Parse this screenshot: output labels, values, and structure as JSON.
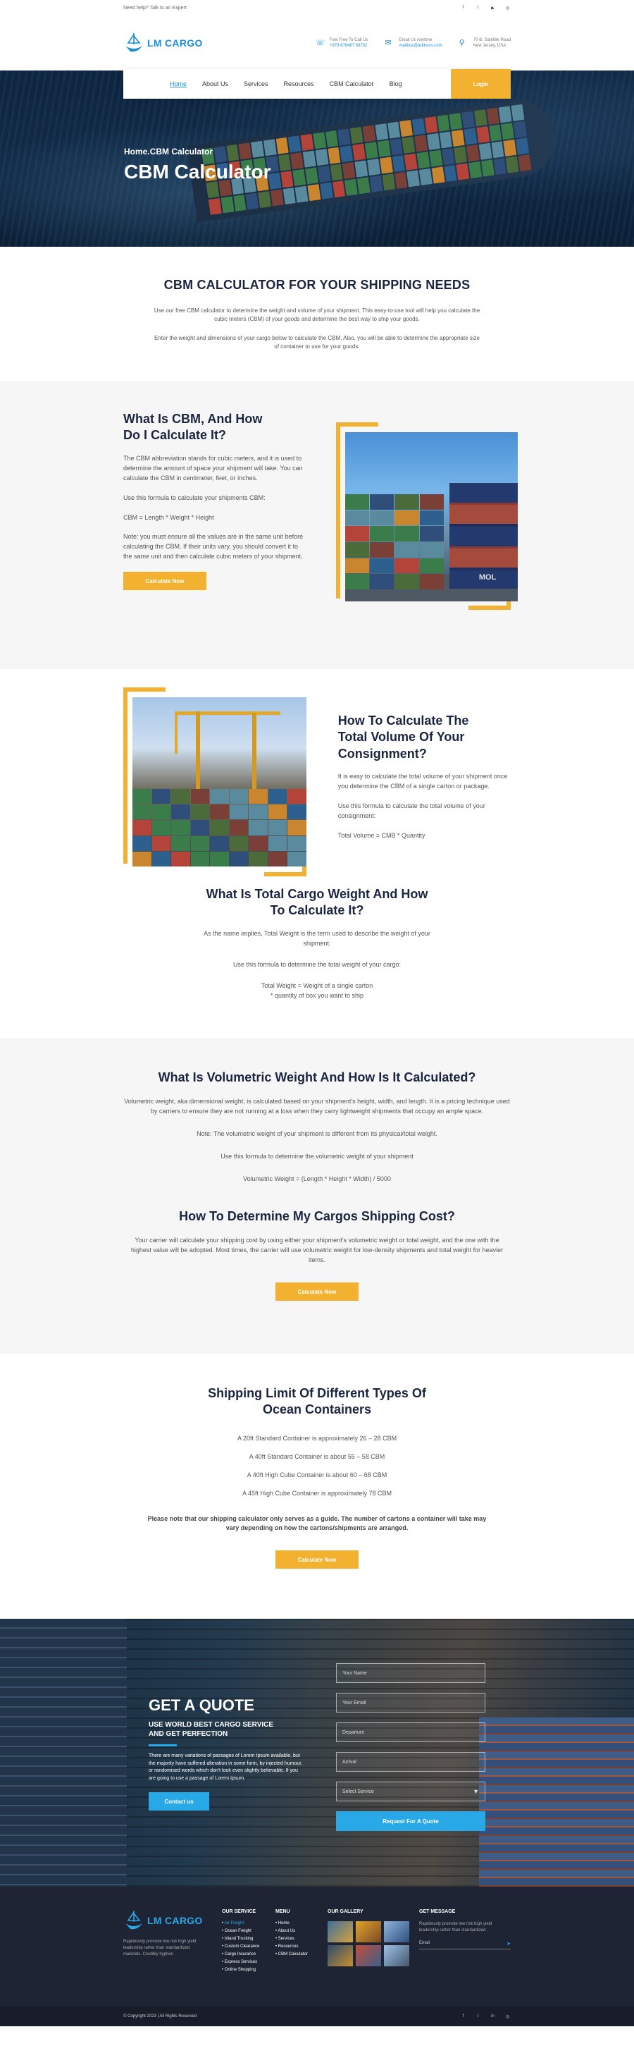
{
  "topbar": {
    "help": "Need help? Talk to an Expert",
    "social_icons": [
      "facebook-icon",
      "twitter-icon",
      "youtube-icon",
      "instagram-icon"
    ]
  },
  "header": {
    "logo": "LM CARGO",
    "contacts": [
      {
        "icon": "phone-icon",
        "line1": "Feel Free To Call Us",
        "line2": "+879 876467 88732"
      },
      {
        "icon": "mail-icon",
        "line1": "Email Us Anytime",
        "line2": "mailbox@address.com"
      },
      {
        "icon": "location-icon",
        "line1": "70-B, Satellite Road",
        "line2": "New Jersey, USA"
      }
    ]
  },
  "nav": {
    "items": [
      "Home",
      "About Us",
      "Services",
      "Resources",
      "CBM Calculator",
      "Blog"
    ],
    "active": "Home",
    "login": "Login"
  },
  "hero": {
    "crumb": "Home.CBM Calculator",
    "title": "CBM Calculator"
  },
  "intro": {
    "title": "CBM CALCULATOR FOR YOUR SHIPPING NEEDS",
    "p1": "Use our free CBM calculator to determine the weight and volume of your shipment. This easy-to-use tool will help you calculate the cubic meters (CBM) of your goods and determine the best way to ship your goods.",
    "p2": "Enter the weight and dimensions of your cargo below to calculate the CBM. Also, you will be able to determine the appropriate size of container to use for your goods."
  },
  "cbm": {
    "title_l1": "What Is CBM, And How",
    "title_l2": "Do I Calculate It?",
    "p1": "The CBM abbreviation stands for cubic meters, and it is used to determine the amount of space your shipment will take. You can calculate the CBM in centimeter, feet, or inches.",
    "p2": "Use this formula to calculate your shipments CBM:",
    "p3": "CBM = Length * Weight * Height",
    "p4": "Note: you must ensure all the values are in the same unit before calculating the CBM. If their units vary, you should convert it to the same unit and then calculate cubic meters of your shipment.",
    "button": "Calculate Now"
  },
  "volume": {
    "title_l1": "How To Calculate The",
    "title_l2": "Total Volume Of Your",
    "title_l3": "Consignment?",
    "p1": "It is easy to calculate the total volume of your shipment once you determine the CBM of a single carton or package.",
    "p2": "Use this formula to calculate the total volume of your consignment:",
    "p3": "Total Volume = CMB * Quantity"
  },
  "weight": {
    "title_l1": "What Is Total Cargo Weight And How",
    "title_l2": "To Calculate It?",
    "p1": "As the name implies, Total Weight is the term used to describe the weight of your shipment.",
    "p2": "Use this formula to determine the total weight of your cargo:",
    "p3": "Total Weight = Weight of a single carton",
    "p4": "* quantity of box you want to ship"
  },
  "volumetric": {
    "title": "What Is Volumetric Weight And How Is It Calculated?",
    "p1": "Volumetric weight, aka dimensional weight, is calculated based on your shipment's height, width, and length. It is a pricing technique used by carriers to ensure they are not running at a loss when they carry lightweight shipments that occupy an ample space.",
    "p2": "Note: The volumetric weight of your shipment is different from its physical/total weight.",
    "p3": "Use this formula to determine the volumetric weight of your shipment",
    "p4": "Volumetric Weight = (Length * Height * Width) / 5000"
  },
  "cost": {
    "title": "How To Determine My Cargos Shipping Cost?",
    "p1": "Your carrier will calculate your shipping cost by using either your shipment's volumetric weight or total weight, and the one with the highest value will be adopted. Most times, the carrier will use volumetric weight for low-density shipments and total weight for heavier items.",
    "button": "Calculate Now"
  },
  "limits": {
    "title_l1": "Shipping Limit Of Different Types Of",
    "title_l2": "Ocean Containers",
    "items": [
      "A 20ft Standard Container is approximately 26 – 28 CBM",
      "A 40ft Standard Container is about 55 – 58 CBM",
      "A 40ft High Cube Container is about 60 – 68 CBM",
      "A 45ft High Cube Container is approximately 78 CBM"
    ],
    "note": "Please note that our shipping calculator only serves as a guide. The number of cartons a container will take may vary depending on how the cartons/shipments are arranged.",
    "button": "Calculate Now"
  },
  "quote": {
    "title": "GET A QUOTE",
    "sub_l1": "USE WORLD BEST CARGO SERVICE",
    "sub_l2": "AND GET PERFECTION",
    "text": "There are many variations of passages of Lorem Ipsum available, but the majority have suffered alteration in some form, by injected humour, or randomised words which don't look even slightly believable. If you are going to use a passage of Lorem Ipsum.",
    "contact_button": "Contact us",
    "fields": {
      "name": "Your Name",
      "email": "Your Email",
      "departure": "Departure",
      "arrival": "Arrival",
      "service": "Select Service"
    },
    "submit": "Request For A Quote"
  },
  "footer": {
    "logo": "LM CARGO",
    "about": "Rapidiously promote low risk high yield leadership rather than standardized materials. Credibly hyphen",
    "service_title": "OUR SERVICE",
    "services": [
      "Air Freight",
      "Ocean Freight",
      "Inland Trucking",
      "Custom Clearance",
      "Cargo Insurance",
      "Express Services",
      "Online Shopping"
    ],
    "menu_title": "MENU",
    "menu": [
      "Home",
      "About Us",
      "Services",
      "Resources",
      "CBM Calculator"
    ],
    "gallery_title": "OUR GALLERY",
    "message_title": "GET MESSAGE",
    "message_text": "Rapidiously promote low risk high yield leadership rather than standardized",
    "email_placeholder": "Email",
    "copyright": "© Copyright 2023 | All Rights Reserved"
  },
  "colors": {
    "accent": "#f2b230",
    "brand": "#1b8fd8",
    "navy": "#1b2540",
    "footer": "#1e2433"
  }
}
